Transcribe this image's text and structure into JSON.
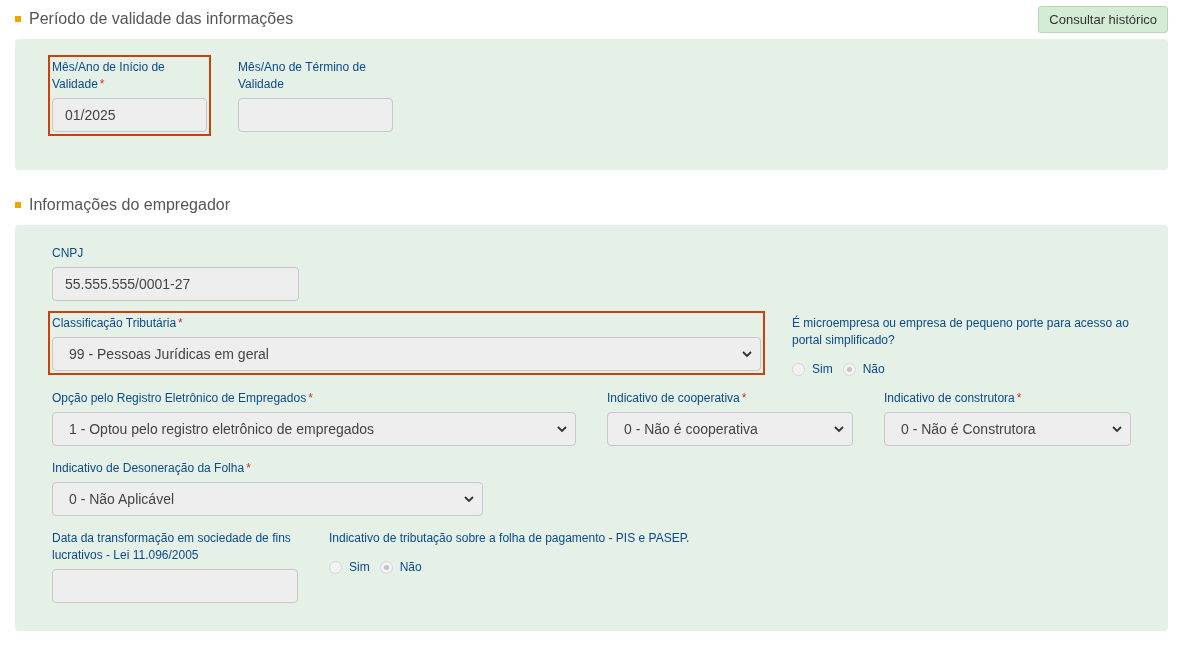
{
  "sections": [
    {
      "title": "Período de validade das informações",
      "header_button": {
        "label": "Consultar histórico"
      },
      "field_rows": [
        {
          "fields": [
            {
              "kind": "text",
              "label": "Mês/Ano de Início de Validade",
              "required_mark": "*",
              "highlighted": true,
              "value": "01/2025"
            },
            {
              "kind": "text",
              "label": "Mês/Ano de Término de Validade",
              "highlighted": false
            }
          ]
        }
      ]
    },
    {
      "title": "Informações do empregador",
      "field_rows": [
        {
          "fields": [
            {
              "kind": "text",
              "label": "CNPJ",
              "highlighted": false,
              "value": "55.555.555/0001-27"
            }
          ]
        },
        {
          "fields": [
            {
              "kind": "select",
              "label": "Classificação Tributária",
              "required_mark": "*",
              "highlighted": true,
              "value": "99 - Pessoas Jurídicas em geral"
            },
            {
              "kind": "radio",
              "label": "É microempresa ou empresa de pequeno porte para acesso ao portal simplificado?",
              "highlighted": false,
              "options": [
                {
                  "label": "Sim",
                  "selected": false
                },
                {
                  "label": "Não",
                  "selected": true
                }
              ]
            }
          ]
        },
        {
          "fields": [
            {
              "kind": "select",
              "label": "Opção pelo Registro Eletrônico de Empregados",
              "required_mark": "*",
              "highlighted": false,
              "value": "1 - Optou pelo registro eletrônico de empregados"
            },
            {
              "kind": "select",
              "label": "Indicativo de cooperativa",
              "required_mark": "*",
              "highlighted": false,
              "value": "0 - Não é cooperativa"
            },
            {
              "kind": "select",
              "label": "Indicativo de construtora",
              "required_mark": "*",
              "highlighted": false,
              "value": "0 - Não é Construtora"
            }
          ]
        },
        {
          "fields": [
            {
              "kind": "select",
              "label": "Indicativo de Desoneração da Folha",
              "required_mark": "*",
              "highlighted": false,
              "value": "0 - Não Aplicável"
            }
          ]
        },
        {
          "fields": [
            {
              "kind": "text",
              "label": "Data da transformação em sociedade de fins lucrativos - Lei 11.096/2005",
              "highlighted": false
            },
            {
              "kind": "radio",
              "label": "Indicativo de tributação sobre a folha de pagamento - PIS e PASEP.",
              "highlighted": false,
              "options": [
                {
                  "label": "Sim",
                  "selected": false
                },
                {
                  "label": "Não",
                  "selected": true
                }
              ]
            }
          ]
        }
      ]
    }
  ]
}
